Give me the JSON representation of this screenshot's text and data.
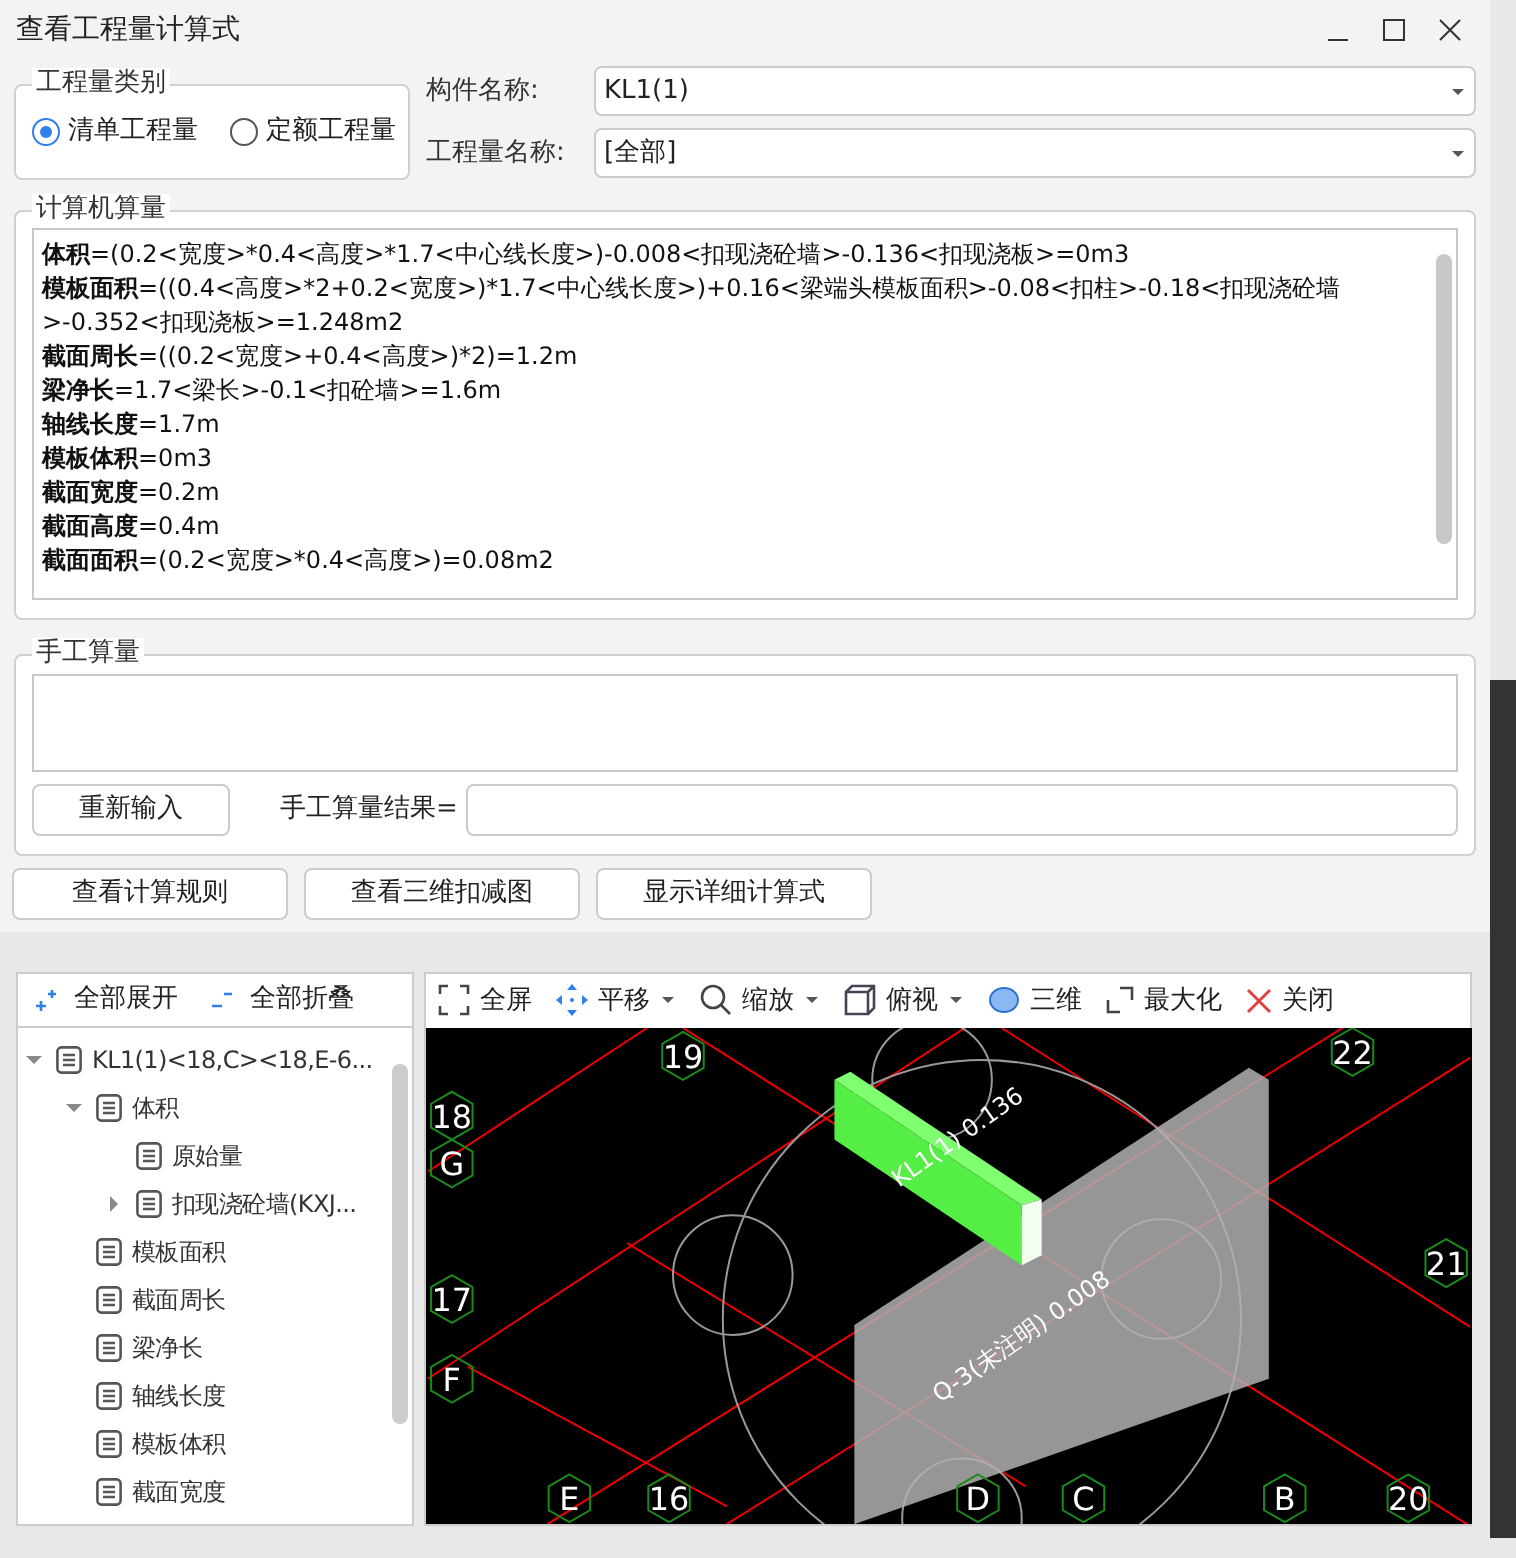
{
  "window": {
    "title": "查看工程量计算式"
  },
  "quantity_type": {
    "legend": "工程量类别",
    "options": [
      {
        "label": "清单工程量",
        "selected": true
      },
      {
        "label": "定额工程量",
        "selected": false
      }
    ]
  },
  "fields": [
    {
      "label": "构件名称:",
      "value": "KL1(1)"
    },
    {
      "label": "工程量名称:",
      "value": "[全部]"
    }
  ],
  "computer_calc": {
    "legend": "计算机算量",
    "lines": [
      "**体积**=(0.2<宽度>*0.4<高度>*1.7<中心线长度>)-0.008<扣现浇砼墙>-0.136<扣现浇板>=0m3",
      "**模板面积**=((0.4<高度>*2+0.2<宽度>)*1.7<中心线长度>)+0.16<梁端头模板面积>-0.08<扣柱>-0.18<扣现浇砼墙>-0.352<扣现浇板>=1.248m2",
      "**截面周长**=((0.2<宽度>+0.4<高度>)*2)=1.2m",
      "**梁净长**=1.7<梁长>-0.1<扣砼墙>=1.6m",
      "**轴线长度**=1.7m",
      "**模板体积**=0m3",
      "**截面宽度**=0.2m",
      "**截面高度**=0.4m",
      "**截面面积**=(0.2<宽度>*0.4<高度>)=0.08m2"
    ]
  },
  "manual_calc": {
    "legend": "手工算量",
    "reenter_button": "重新输入",
    "result_label": "手工算量结果="
  },
  "buttons": [
    "查看计算规则",
    "查看三维扣减图",
    "显示详细计算式"
  ],
  "tree_toolbar": [
    {
      "kind": "expand",
      "label": "全部展开"
    },
    {
      "kind": "collapse",
      "label": "全部折叠"
    }
  ],
  "tree": [
    {
      "label": "KL1(1)<18,C><18,E-6...",
      "expanded": true,
      "children": [
        {
          "label": "体积",
          "expanded": true,
          "children": [
            {
              "label": "原始量"
            },
            {
              "label": "扣现浇砼墙(KXJ...",
              "expanded": false
            }
          ]
        },
        {
          "label": "模板面积"
        },
        {
          "label": "截面周长"
        },
        {
          "label": "梁净长"
        },
        {
          "label": "轴线长度"
        },
        {
          "label": "模板体积"
        },
        {
          "label": "截面宽度"
        }
      ]
    }
  ],
  "view_toolbar": [
    {
      "kind": "fullscreen",
      "label": "全屏",
      "dropdown": false
    },
    {
      "kind": "pan",
      "label": "平移",
      "dropdown": true
    },
    {
      "kind": "zoom",
      "label": "缩放",
      "dropdown": true
    },
    {
      "kind": "view",
      "label": "俯视",
      "dropdown": true
    },
    {
      "kind": "orbit",
      "label": "三维",
      "dropdown": false
    },
    {
      "kind": "maximize",
      "label": "最大化",
      "dropdown": false
    },
    {
      "kind": "close",
      "label": "关闭",
      "dropdown": false
    }
  ],
  "view": {
    "axis_labels": [
      "19",
      "18",
      "G",
      "17",
      "F",
      "E",
      "16",
      "D",
      "C",
      "B",
      "20",
      "21",
      "22"
    ],
    "objects": [
      {
        "kind": "beam",
        "label": "KL1(1) 0.136"
      },
      {
        "kind": "wall",
        "label": "Q-3(未注明)  0.008"
      }
    ]
  }
}
